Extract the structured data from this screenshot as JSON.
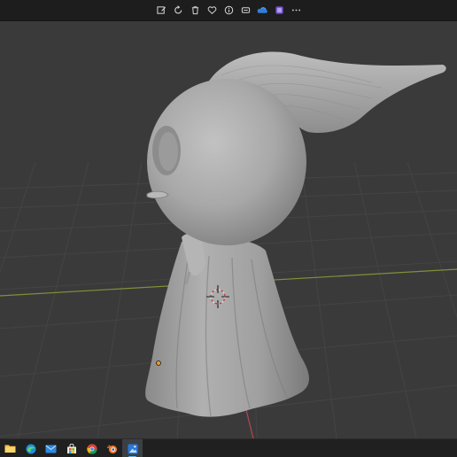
{
  "toolbar": {
    "buttons": [
      {
        "icon": "edit-image-icon"
      },
      {
        "icon": "rotate-icon"
      },
      {
        "icon": "delete-icon"
      },
      {
        "icon": "favorite-icon"
      },
      {
        "icon": "info-icon"
      },
      {
        "icon": "share-icon"
      },
      {
        "icon": "onedrive-icon"
      },
      {
        "icon": "clipchamp-icon"
      },
      {
        "icon": "more-options-icon"
      }
    ]
  },
  "viewport": {
    "background": "#3a3a3a",
    "grid_color": "#464646",
    "x_axis_color": "#8a9a3a",
    "y_axis_color": "#b0454f",
    "model_color": "#9e9e9e"
  },
  "taskbar": {
    "apps": [
      {
        "icon": "file-explorer-icon"
      },
      {
        "icon": "edge-icon"
      },
      {
        "icon": "mail-icon"
      },
      {
        "icon": "store-icon"
      },
      {
        "icon": "chrome-icon"
      },
      {
        "icon": "blender-icon"
      },
      {
        "icon": "photos-app-icon",
        "active": true
      }
    ]
  }
}
